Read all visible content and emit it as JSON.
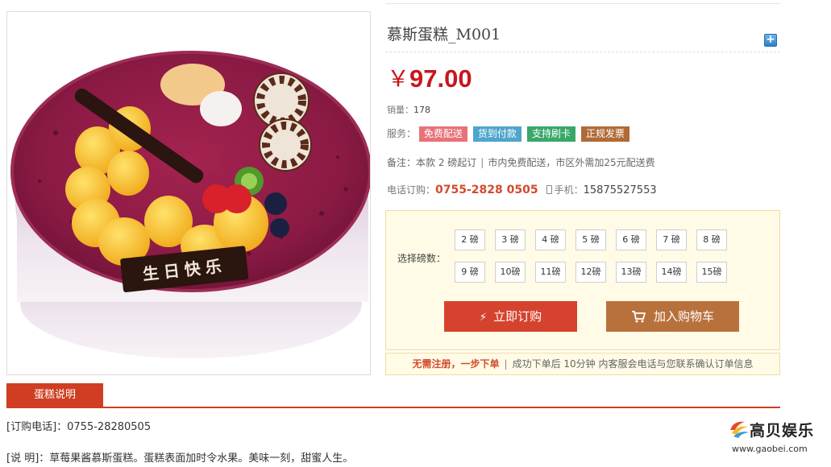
{
  "product": {
    "title": "慕斯蛋糕_M001",
    "currency": "￥",
    "price": "97.00",
    "image_badge": "生日快乐"
  },
  "sales": {
    "label": "销量：",
    "count": "178"
  },
  "services": {
    "label": "服务：",
    "tags": [
      "免费配送",
      "货到付款",
      "支持刷卡",
      "正规发票"
    ],
    "colors": [
      "#e8727a",
      "#4ea5cc",
      "#39a76a",
      "#b06a35"
    ]
  },
  "remark": {
    "label": "备注：",
    "min_order": "本款 2 磅起订",
    "separator": "|",
    "delivery": "市内免费配送，市区外需加25元配送费"
  },
  "contact": {
    "phone_label": "电话订购：",
    "phone": "0755-2828 0505",
    "mobile_label": "手机：",
    "mobile": "15875527553"
  },
  "weight_select": {
    "label": "选择磅数：",
    "options": [
      "2 磅",
      "3 磅",
      "4 磅",
      "5 磅",
      "6 磅",
      "7 磅",
      "8 磅",
      "9 磅",
      "10磅",
      "11磅",
      "12磅",
      "13磅",
      "14磅",
      "15磅"
    ]
  },
  "actions": {
    "order_now": "立即订购",
    "add_to_cart": "加入购物车"
  },
  "notice": {
    "highlight": "无需注册，一步下单",
    "separator": "|",
    "text": "成功下单后 10分钟 内客服会电话与您联系确认订单信息"
  },
  "tabs": [
    "蛋糕说明"
  ],
  "description": {
    "phone_line": "[订购电话]：0755-28280505",
    "desc_line": "[说 明]：草莓果酱慕斯蛋糕。蛋糕表面加时令水果。美味一刻，甜蜜人生。"
  },
  "watermark": {
    "name": "高贝娱乐",
    "url": "www.gaobei.com"
  }
}
